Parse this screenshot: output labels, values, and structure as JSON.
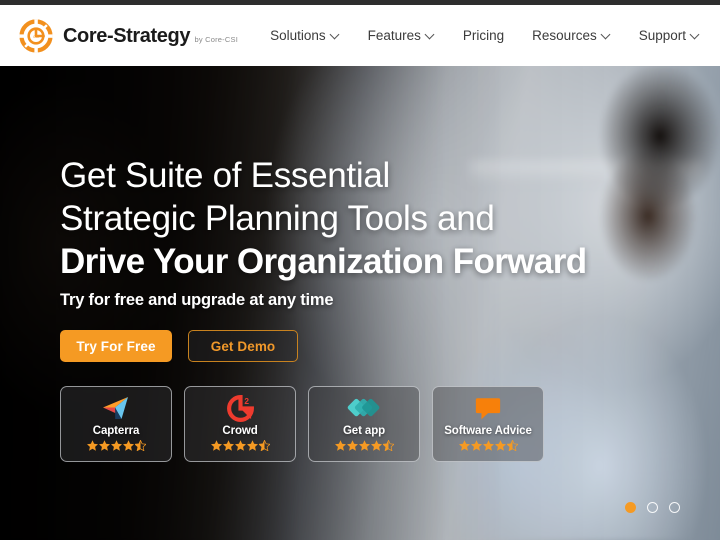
{
  "brand": {
    "name": "Core-Strategy",
    "tagline": "by Core-CSI",
    "logo_icon": "core-strategy-circular-g-logo",
    "logo_color": "#F2901E"
  },
  "nav": {
    "items": [
      {
        "label": "Solutions",
        "has_dropdown": true
      },
      {
        "label": "Features",
        "has_dropdown": true
      },
      {
        "label": "Pricing",
        "has_dropdown": false
      },
      {
        "label": "Resources",
        "has_dropdown": true
      },
      {
        "label": "Support",
        "has_dropdown": true
      }
    ]
  },
  "hero": {
    "headline_line1": "Get Suite of Essential",
    "headline_line2": "Strategic Planning Tools and",
    "headline_line3": "Drive Your Organization Forward",
    "subhead": "Try for free and upgrade at any time",
    "primary_cta": "Try For Free",
    "secondary_cta": "Get Demo",
    "accent_color": "#F59A23"
  },
  "badges": [
    {
      "label": "Capterra",
      "icon": "capterra-paper-plane-icon",
      "rating": 4.5,
      "full_stars": 4,
      "half_star": true
    },
    {
      "label": "Crowd",
      "icon": "g2-crowd-logo-icon",
      "rating": 4.5,
      "full_stars": 4,
      "half_star": true
    },
    {
      "label": "Get app",
      "icon": "getapp-diamonds-icon",
      "rating": 4.5,
      "full_stars": 4,
      "half_star": true
    },
    {
      "label": "Software Advice",
      "icon": "software-advice-speech-bubble-icon",
      "rating": 4.5,
      "full_stars": 4,
      "half_star": true
    }
  ],
  "carousel": {
    "total": 3,
    "active_index": 0,
    "active_color": "#F59A23"
  }
}
